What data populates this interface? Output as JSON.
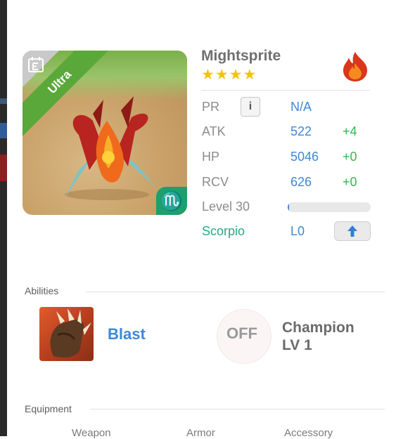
{
  "monster": {
    "name": "Mightsprite",
    "stars": "★★★★",
    "rarity": "Ultra",
    "sign_glyph": "♏",
    "element_icon": "fire-element-icon"
  },
  "stats": {
    "pr": {
      "label": "PR",
      "info_glyph": "i",
      "value": "N/A"
    },
    "atk": {
      "label": "ATK",
      "value": "522",
      "bonus": "+4"
    },
    "hp": {
      "label": "HP",
      "value": "5046",
      "bonus": "+0"
    },
    "rcv": {
      "label": "RCV",
      "value": "626",
      "bonus": "+0"
    },
    "level": {
      "label": "Level 30",
      "progress": 0.02
    },
    "sign": {
      "label": "Scorpio",
      "value": "L0",
      "upgrade_icon": "up-arrow-icon"
    }
  },
  "abilities": {
    "title": "Abilities",
    "skill_name": "Blast",
    "skill_icon": "claw-icon",
    "toggle_label": "OFF",
    "champion_title": "Champion",
    "champion_level": "LV 1"
  },
  "equipment": {
    "title": "Equipment",
    "tabs": [
      "Weapon",
      "Armor",
      "Accessory"
    ]
  },
  "colors": {
    "accent_blue": "#3d88d8",
    "bonus_green": "#39b54a",
    "rarity_green": "#5aa83a",
    "sign_green": "#1fae7a",
    "star_gold": "#f1c40f"
  }
}
